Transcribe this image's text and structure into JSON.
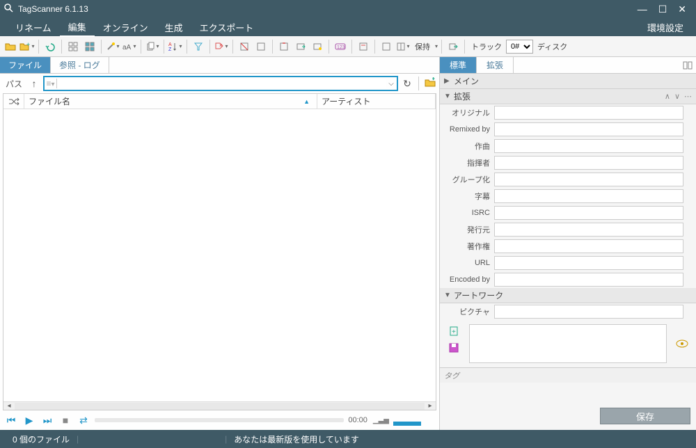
{
  "titlebar": {
    "title": "TagScanner 6.1.13"
  },
  "menubar": {
    "rename": "リネーム",
    "edit": "編集",
    "online": "オンライン",
    "generate": "生成",
    "export": "エクスポート",
    "settings": "環境設定"
  },
  "toolbar": {
    "keep": "保持",
    "track": "トラック",
    "track_value": "0#",
    "disc": "ディスク"
  },
  "left": {
    "tab_file": "ファイル",
    "tab_browse": "参照 - ログ",
    "path_label": "パス",
    "col_filename": "ファイル名",
    "col_artist": "アーティスト",
    "time": "00:00"
  },
  "right": {
    "tab_standard": "標準",
    "tab_extended": "拡張",
    "section_main": "メイン",
    "section_extended": "拡張",
    "section_artwork": "アートワーク",
    "fields": {
      "original": "オリジナル",
      "remixed_by": "Remixed by",
      "composer": "作曲",
      "conductor": "指揮者",
      "grouping": "グループ化",
      "subtitle": "字幕",
      "isrc": "ISRC",
      "publisher": "発行元",
      "copyright": "著作権",
      "url": "URL",
      "encoded_by": "Encoded by",
      "picture": "ピクチャ"
    },
    "tag_label": "タグ",
    "save": "保存"
  },
  "statusbar": {
    "files": "0 個のファイル",
    "version": "あなたは最新版を使用しています"
  }
}
